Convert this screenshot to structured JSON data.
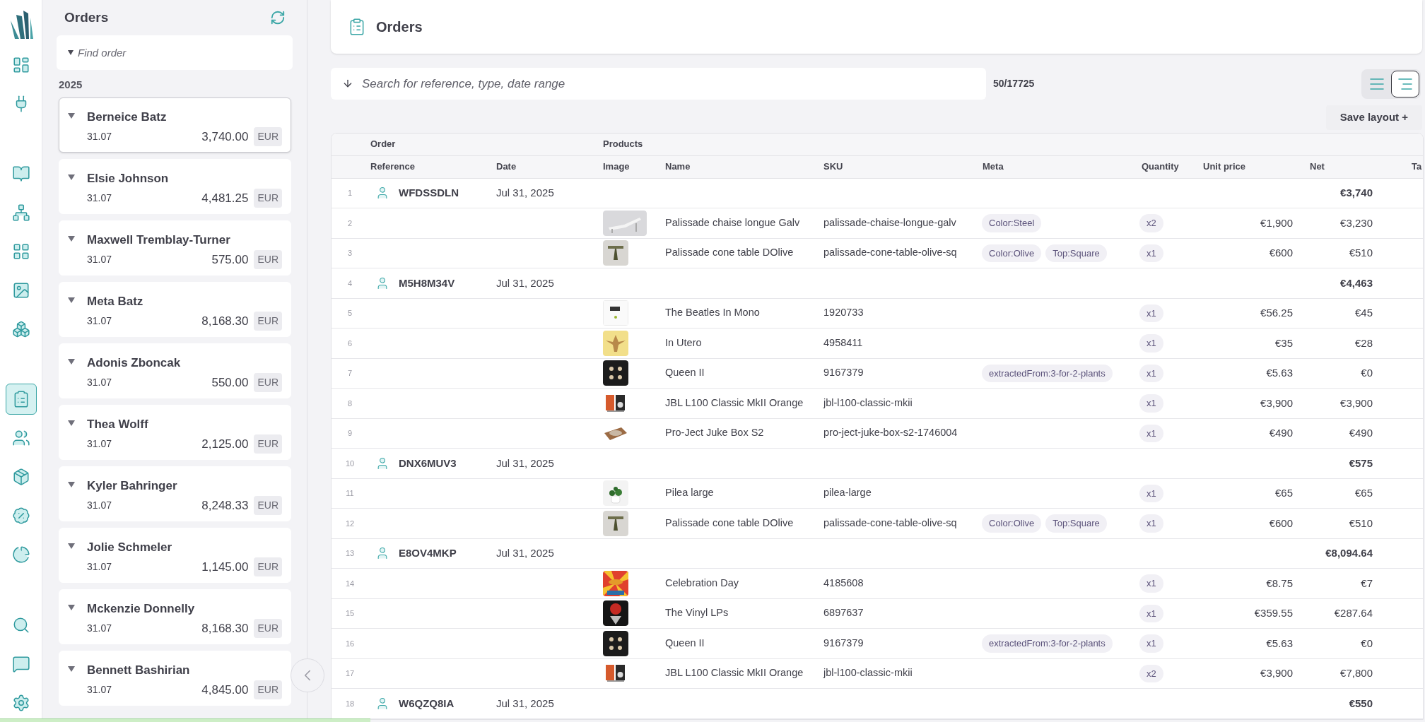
{
  "rail": {
    "sections": [
      [
        {
          "selected": false
        },
        {
          "selected": false
        }
      ],
      [
        {
          "selected": false
        },
        {
          "selected": false
        },
        {
          "selected": false
        },
        {
          "selected": false
        },
        {
          "selected": false
        }
      ],
      [
        {
          "selected": true
        },
        {
          "selected": false
        },
        {
          "selected": false
        },
        {
          "selected": false
        },
        {
          "selected": false
        }
      ],
      [
        {
          "selected": false
        },
        {
          "selected": false
        },
        {
          "selected": false
        }
      ]
    ]
  },
  "orders_panel": {
    "title": "Orders",
    "search": {
      "placeholder": "Find order"
    },
    "year": "2025",
    "orders": [
      {
        "name": "Berneice Batz",
        "date": "31.07",
        "amount": "3,740.00",
        "currency": "EUR",
        "selected": true
      },
      {
        "name": "Elsie Johnson",
        "date": "31.07",
        "amount": "4,481.25",
        "currency": "EUR",
        "selected": false
      },
      {
        "name": "Maxwell Tremblay-Turner",
        "date": "31.07",
        "amount": "575.00",
        "currency": "EUR",
        "selected": false
      },
      {
        "name": "Meta Batz",
        "date": "31.07",
        "amount": "8,168.30",
        "currency": "EUR",
        "selected": false
      },
      {
        "name": "Adonis Zboncak",
        "date": "31.07",
        "amount": "550.00",
        "currency": "EUR",
        "selected": false
      },
      {
        "name": "Thea Wolff",
        "date": "31.07",
        "amount": "2,125.00",
        "currency": "EUR",
        "selected": false
      },
      {
        "name": "Kyler Bahringer",
        "date": "31.07",
        "amount": "8,248.33",
        "currency": "EUR",
        "selected": false
      },
      {
        "name": "Jolie Schmeler",
        "date": "31.07",
        "amount": "1,145.00",
        "currency": "EUR",
        "selected": false
      },
      {
        "name": "Mckenzie Donnelly",
        "date": "31.07",
        "amount": "8,168.30",
        "currency": "EUR",
        "selected": false
      },
      {
        "name": "Bennett Bashirian",
        "date": "31.07",
        "amount": "4,845.00",
        "currency": "EUR",
        "selected": false
      }
    ]
  },
  "page": {
    "title": "Orders"
  },
  "search": {
    "placeholder": "Search for reference, type, date range"
  },
  "count": "50/17725",
  "view_toggle": [
    {
      "selected": false
    },
    {
      "selected": true
    }
  ],
  "save_layout": "Save layout +",
  "table": {
    "groups": [
      {
        "label": "Order"
      },
      {
        "label": "Products"
      }
    ],
    "columns": [
      "Reference",
      "Date",
      "Image",
      "Name",
      "SKU",
      "Meta",
      "Quantity",
      "Unit price",
      "Net",
      "Ta"
    ],
    "rows": [
      {
        "number": "1",
        "kind": "order",
        "reference": "WFDSSDLN",
        "date": "Jul 31, 2025",
        "total": "€3,740"
      },
      {
        "number": "2",
        "kind": "product",
        "name": "Palissade chaise longue Galv",
        "sku": "palissade-chaise-longue-galv",
        "meta": [
          "Color:Steel"
        ],
        "quantity": "x2",
        "unit_price": "€1,900",
        "net": "€3,230"
      },
      {
        "number": "3",
        "kind": "product",
        "name": "Palissade cone table DOlive",
        "sku": "palissade-cone-table-olive-sq",
        "meta": [
          "Color:Olive",
          "Top:Square"
        ],
        "quantity": "x1",
        "unit_price": "€600",
        "net": "€510"
      },
      {
        "number": "4",
        "kind": "order",
        "reference": "M5H8M34V",
        "date": "Jul 31, 2025",
        "total": "€4,463"
      },
      {
        "number": "5",
        "kind": "product",
        "name": "The Beatles In Mono",
        "sku": "1920733",
        "quantity": "x1",
        "unit_price": "€56.25",
        "net": "€45"
      },
      {
        "number": "6",
        "kind": "product",
        "name": "In Utero",
        "sku": "4958411",
        "quantity": "x1",
        "unit_price": "€35",
        "net": "€28"
      },
      {
        "number": "7",
        "kind": "product",
        "name": "Queen II",
        "sku": "9167379",
        "meta": [
          "extractedFrom:3-for-2-plants"
        ],
        "quantity": "x1",
        "unit_price": "€5.63",
        "net": "€0"
      },
      {
        "number": "8",
        "kind": "product",
        "name": "JBL L100 Classic MkII Orange",
        "sku": "jbl-l100-classic-mkii",
        "quantity": "x1",
        "unit_price": "€3,900",
        "net": "€3,900"
      },
      {
        "number": "9",
        "kind": "product",
        "name": "Pro-Ject Juke Box S2",
        "sku": "pro-ject-juke-box-s2-1746004",
        "quantity": "x1",
        "unit_price": "€490",
        "net": "€490"
      },
      {
        "number": "10",
        "kind": "order",
        "reference": "DNX6MUV3",
        "date": "Jul 31, 2025",
        "total": "€575"
      },
      {
        "number": "11",
        "kind": "product",
        "name": "Pilea large",
        "sku": "pilea-large",
        "quantity": "x1",
        "unit_price": "€65",
        "net": "€65"
      },
      {
        "number": "12",
        "kind": "product",
        "name": "Palissade cone table DOlive",
        "sku": "palissade-cone-table-olive-sq",
        "meta": [
          "Color:Olive",
          "Top:Square"
        ],
        "quantity": "x1",
        "unit_price": "€600",
        "net": "€510"
      },
      {
        "number": "13",
        "kind": "order",
        "reference": "E8OV4MKP",
        "date": "Jul 31, 2025",
        "total": "€8,094.64"
      },
      {
        "number": "14",
        "kind": "product",
        "name": "Celebration Day",
        "sku": "4185608",
        "quantity": "x1",
        "unit_price": "€8.75",
        "net": "€7"
      },
      {
        "number": "15",
        "kind": "product",
        "name": "The Vinyl LPs",
        "sku": "6897637",
        "quantity": "x1",
        "unit_price": "€359.55",
        "net": "€287.64"
      },
      {
        "number": "16",
        "kind": "product",
        "name": "Queen II",
        "sku": "9167379",
        "meta": [
          "extractedFrom:3-for-2-plants"
        ],
        "quantity": "x1",
        "unit_price": "€5.63",
        "net": "€0"
      },
      {
        "number": "17",
        "kind": "product",
        "name": "JBL L100 Classic MkII Orange",
        "sku": "jbl-l100-classic-mkii",
        "quantity": "x2",
        "unit_price": "€3,900",
        "net": "€7,800"
      },
      {
        "number": "18",
        "kind": "order",
        "reference": "W6QZQ8IA",
        "date": "Jul 31, 2025",
        "total": "€550"
      }
    ]
  },
  "loading_bar": {
    "level": 0.26
  }
}
